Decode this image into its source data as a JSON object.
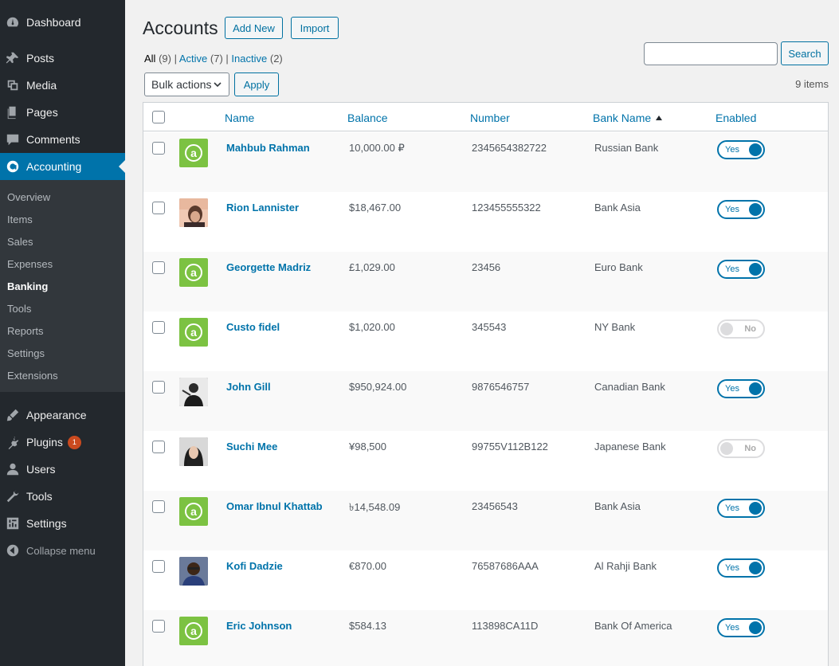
{
  "sidebar": {
    "items": [
      {
        "label": "Dashboard",
        "icon": "dashboard-icon"
      },
      {
        "label": "Posts",
        "icon": "pin-icon"
      },
      {
        "label": "Media",
        "icon": "media-icon"
      },
      {
        "label": "Pages",
        "icon": "pages-icon"
      },
      {
        "label": "Comments",
        "icon": "comment-icon"
      },
      {
        "label": "Accounting",
        "icon": "accounting-icon"
      }
    ],
    "submenu": [
      "Overview",
      "Items",
      "Sales",
      "Expenses",
      "Banking",
      "Tools",
      "Reports",
      "Settings",
      "Extensions"
    ],
    "items2": [
      {
        "label": "Appearance",
        "icon": "brush-icon"
      },
      {
        "label": "Plugins",
        "icon": "plugin-icon",
        "badge": "1"
      },
      {
        "label": "Users",
        "icon": "user-icon"
      },
      {
        "label": "Tools",
        "icon": "wrench-icon"
      },
      {
        "label": "Settings",
        "icon": "settings-icon"
      },
      {
        "label": "Collapse menu",
        "icon": "collapse-icon"
      }
    ]
  },
  "page": {
    "title": "Accounts",
    "add_new": "Add New",
    "import": "Import"
  },
  "views": {
    "all_label": "All",
    "all_count": "(9)",
    "active_label": "Active",
    "active_count": "(7)",
    "inactive_label": "Inactive",
    "inactive_count": "(2)"
  },
  "search": {
    "value": "",
    "button": "Search"
  },
  "bulk": {
    "selected": "Bulk actions",
    "apply": "Apply"
  },
  "item_count": "9 items",
  "table": {
    "headers": {
      "name": "Name",
      "balance": "Balance",
      "number": "Number",
      "bank": "Bank Name",
      "enabled": "Enabled"
    },
    "rows": [
      {
        "name": "Mahbub Rahman",
        "balance": "10,000.00 ₽",
        "number": "2345654382722",
        "bank": "Russian Bank",
        "enabled": "Yes"
      },
      {
        "name": "Rion Lannister",
        "balance": "$18,467.00",
        "number": "123455555322",
        "bank": "Bank Asia",
        "enabled": "Yes"
      },
      {
        "name": "Georgette Madriz",
        "balance": "£1,029.00",
        "number": "23456",
        "bank": "Euro Bank",
        "enabled": "Yes"
      },
      {
        "name": "Custo fidel",
        "balance": "$1,020.00",
        "number": "345543",
        "bank": "NY Bank",
        "enabled": "No"
      },
      {
        "name": "John Gill",
        "balance": "$950,924.00",
        "number": "9876546757",
        "bank": "Canadian Bank",
        "enabled": "Yes"
      },
      {
        "name": "Suchi Mee",
        "balance": "¥98,500",
        "number": "99755V112B122",
        "bank": "Japanese Bank",
        "enabled": "No"
      },
      {
        "name": "Omar Ibnul Khattab",
        "balance": "৳14,548.09",
        "number": "23456543",
        "bank": "Bank Asia",
        "enabled": "Yes"
      },
      {
        "name": "Kofi Dadzie",
        "balance": "€870.00",
        "number": "76587686AAA",
        "bank": "Al Rahji Bank",
        "enabled": "Yes"
      },
      {
        "name": "Eric Johnson",
        "balance": "$584.13",
        "number": "113898CA11D",
        "bank": "Bank Of America",
        "enabled": "Yes"
      }
    ]
  },
  "colors": {
    "sidebar_bg": "#23282d",
    "accent": "#0073aa",
    "logo_green": "#7cc242",
    "badge": "#ca4a1f"
  }
}
